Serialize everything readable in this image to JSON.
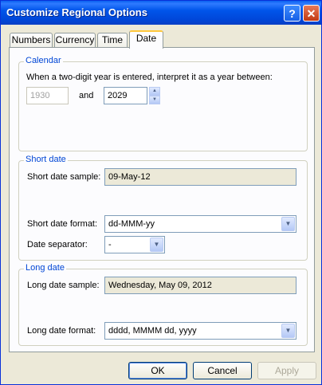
{
  "window": {
    "title": "Customize Regional Options"
  },
  "tabs": [
    {
      "label": "Numbers"
    },
    {
      "label": "Currency"
    },
    {
      "label": "Time"
    },
    {
      "label": "Date"
    }
  ],
  "calendar": {
    "legend": "Calendar",
    "description": "When a two-digit year is entered, interpret it as a year between:",
    "from_year": "1930",
    "and_label": "and",
    "to_year": "2029"
  },
  "short_date": {
    "legend": "Short date",
    "sample_label": "Short date sample:",
    "sample_value": "09-May-12",
    "format_label": "Short date format:",
    "format_value": "dd-MMM-yy",
    "separator_label": "Date separator:",
    "separator_value": "-"
  },
  "long_date": {
    "legend": "Long date",
    "sample_label": "Long date sample:",
    "sample_value": "Wednesday, May 09, 2012",
    "format_label": "Long date format:",
    "format_value": "dddd, MMMM dd, yyyy"
  },
  "buttons": {
    "ok": "OK",
    "cancel": "Cancel",
    "apply": "Apply"
  },
  "title_buttons": {
    "help": "?",
    "close": "✕"
  }
}
